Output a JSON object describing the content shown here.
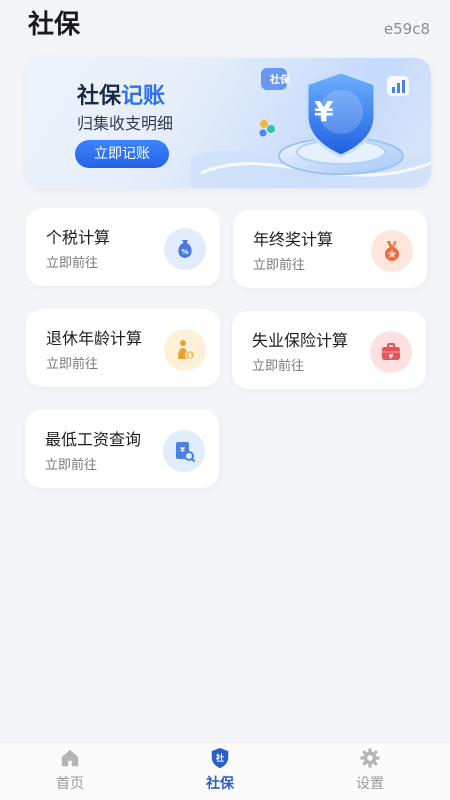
{
  "header": {
    "title": "社保",
    "code": "e59c8"
  },
  "banner": {
    "title_plain": "社保",
    "title_highlight": "记账",
    "subtitle": "归集收支明细",
    "button_label": "立即记账",
    "badge_text": "社保",
    "currency_symbol": "¥"
  },
  "cards": [
    {
      "title": "个税计算",
      "subtitle": "立即前往",
      "icon": "money-bag-icon",
      "icon_bg": "#e3ecfd",
      "icon_color": "#4a78e0"
    },
    {
      "title": "年终奖计算",
      "subtitle": "立即前往",
      "icon": "medal-icon",
      "icon_bg": "#fde6dc",
      "icon_color": "#ee6a3f"
    },
    {
      "title": "退休年龄计算",
      "subtitle": "立即前往",
      "icon": "retirement-icon",
      "icon_bg": "#fdf0d8",
      "icon_color": "#f1a02b"
    },
    {
      "title": "失业保险计算",
      "subtitle": "立即前往",
      "icon": "briefcase-icon",
      "icon_bg": "#fde1e1",
      "icon_color": "#e9545a"
    },
    {
      "title": "最低工资查询",
      "subtitle": "立即前往",
      "icon": "wage-search-icon",
      "icon_bg": "#e1ecfc",
      "icon_color": "#4d82e3"
    }
  ],
  "tabbar": {
    "items": [
      {
        "label": "首页",
        "icon": "home-icon",
        "active": false
      },
      {
        "label": "社保",
        "icon": "shield-icon",
        "active": true
      },
      {
        "label": "设置",
        "icon": "settings-gear-icon",
        "active": false
      }
    ],
    "active_color": "#2d5fc6",
    "inactive_color": "#9a9a9a"
  }
}
